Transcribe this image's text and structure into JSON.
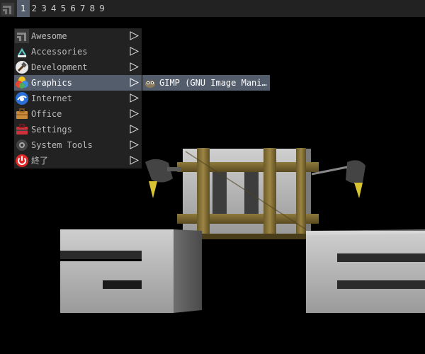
{
  "topbar": {
    "launcher_icon": "awesome-launcher-icon",
    "tags": [
      "1",
      "2",
      "3",
      "4",
      "5",
      "6",
      "7",
      "8",
      "9"
    ],
    "active_tag_index": 0
  },
  "menu": {
    "items": [
      {
        "label": "Awesome",
        "icon": "awesome-icon"
      },
      {
        "label": "Accessories",
        "icon": "accessories-icon"
      },
      {
        "label": "Development",
        "icon": "development-icon"
      },
      {
        "label": "Graphics",
        "icon": "graphics-icon"
      },
      {
        "label": "Internet",
        "icon": "internet-icon"
      },
      {
        "label": "Office",
        "icon": "office-icon"
      },
      {
        "label": "Settings",
        "icon": "settings-icon"
      },
      {
        "label": "System Tools",
        "icon": "system-tools-icon"
      },
      {
        "label": "終了",
        "icon": "power-icon"
      }
    ],
    "focused_index": 3
  },
  "submenu": {
    "items": [
      {
        "label": "GIMP (GNU Image Mani…",
        "icon": "gimp-icon"
      }
    ]
  },
  "colors": {
    "bar_bg": "#222222",
    "focus_bg": "#535d6c",
    "text": "#bbbbbb"
  }
}
